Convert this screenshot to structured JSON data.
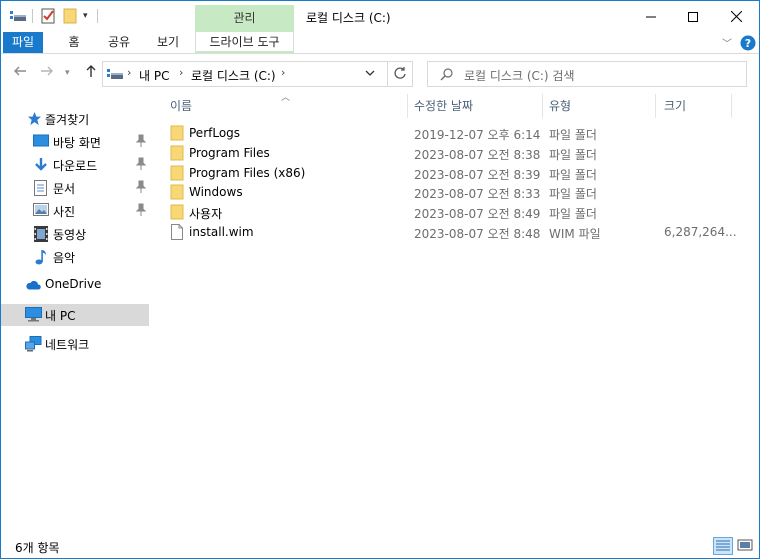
{
  "title_bar": {
    "context_tab": "관리",
    "window_title": "로컬 디스크 (C:)"
  },
  "ribbon": {
    "tabs": [
      "파일",
      "홈",
      "공유",
      "보기"
    ],
    "context_tab": "드라이브 도구"
  },
  "address": {
    "crumbs": [
      "내 PC",
      "로컬 디스크 (C:)"
    ],
    "search_placeholder": "로컬 디스크 (C:) 검색"
  },
  "sidebar": {
    "quick_access": "즐겨찾기",
    "pinned": [
      {
        "label": "바탕 화면",
        "icon": "desktop-icon",
        "pinned": true
      },
      {
        "label": "다운로드",
        "icon": "download-icon",
        "pinned": true
      },
      {
        "label": "문서",
        "icon": "documents-icon",
        "pinned": true
      },
      {
        "label": "사진",
        "icon": "pictures-icon",
        "pinned": true
      },
      {
        "label": "동영상",
        "icon": "videos-icon",
        "pinned": false
      },
      {
        "label": "음악",
        "icon": "music-icon",
        "pinned": false
      }
    ],
    "onedrive": "OneDrive",
    "this_pc": "내 PC",
    "network": "네트워크"
  },
  "columns": {
    "name": "이름",
    "date": "수정한 날짜",
    "type": "유형",
    "size": "크기"
  },
  "files": [
    {
      "name": "PerfLogs",
      "date": "2019-12-07 오후 6:14",
      "type": "파일 폴더",
      "size": "",
      "icon": "folder-icon"
    },
    {
      "name": "Program Files",
      "date": "2023-08-07 오전 8:38",
      "type": "파일 폴더",
      "size": "",
      "icon": "folder-icon"
    },
    {
      "name": "Program Files (x86)",
      "date": "2023-08-07 오전 8:39",
      "type": "파일 폴더",
      "size": "",
      "icon": "folder-icon"
    },
    {
      "name": "Windows",
      "date": "2023-08-07 오전 8:33",
      "type": "파일 폴더",
      "size": "",
      "icon": "folder-icon"
    },
    {
      "name": "사용자",
      "date": "2023-08-07 오전 8:49",
      "type": "파일 폴더",
      "size": "",
      "icon": "folder-icon"
    },
    {
      "name": "install.wim",
      "date": "2023-08-07 오전 8:48",
      "type": "WIM 파일",
      "size": "6,287,264...",
      "icon": "file-icon"
    }
  ],
  "status": {
    "item_count": "6개 항목"
  },
  "colors": {
    "accent": "#1979ca",
    "context_tab": "#c7eac4",
    "folder": "#f8d775",
    "selection": "#d9d9d9"
  }
}
